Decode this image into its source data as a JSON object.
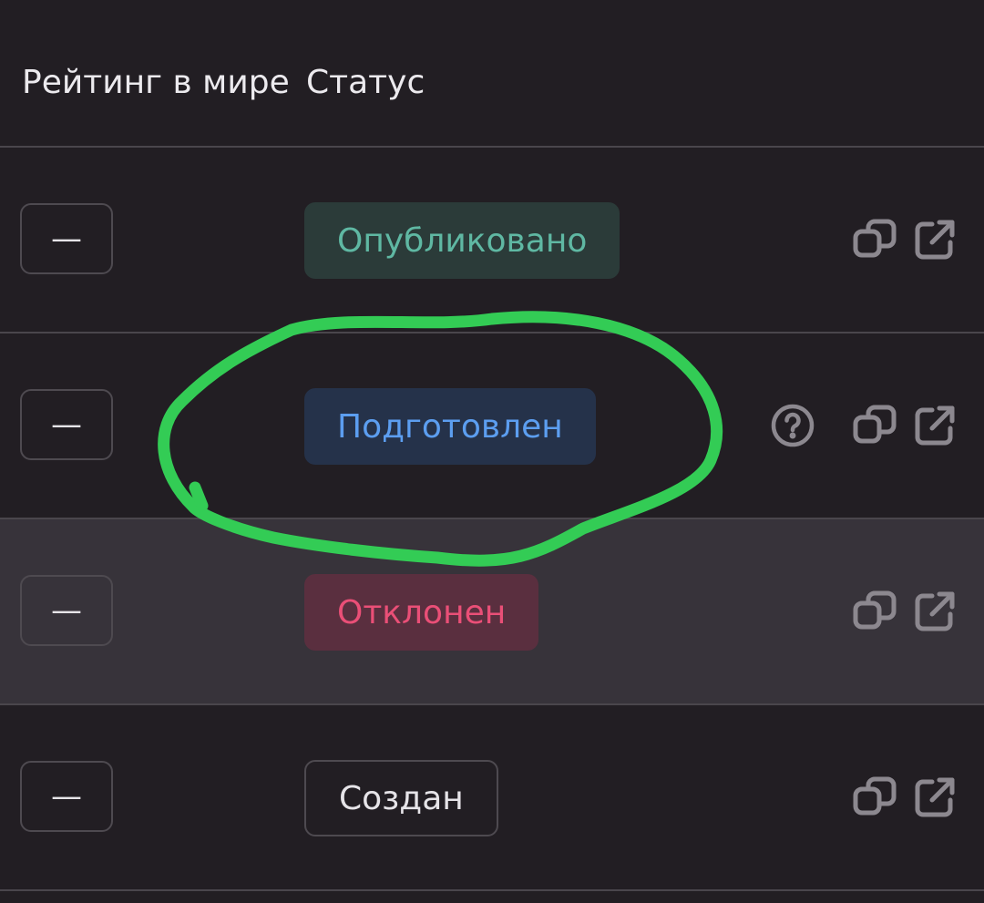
{
  "header": {
    "rating_label": "Рейтинг в мире",
    "status_label": "Статус"
  },
  "rows": [
    {
      "rating": "—",
      "status": "Опубликовано",
      "status_kind": "published",
      "has_help": false
    },
    {
      "rating": "—",
      "status": "Подготовлен",
      "status_kind": "prepared",
      "has_help": true
    },
    {
      "rating": "—",
      "status": "Отклонен",
      "status_kind": "rejected",
      "has_help": false
    },
    {
      "rating": "—",
      "status": "Создан",
      "status_kind": "created",
      "has_help": false
    }
  ],
  "icons": {
    "help": "question-circle-icon",
    "copy": "copy-icon",
    "open": "external-link-icon"
  },
  "colors": {
    "background": "#221e23",
    "hover_row": "#37333a",
    "published": "#5fb8a3",
    "prepared": "#5c9ef0",
    "rejected": "#ea4f77",
    "annotation": "#33cc55"
  }
}
